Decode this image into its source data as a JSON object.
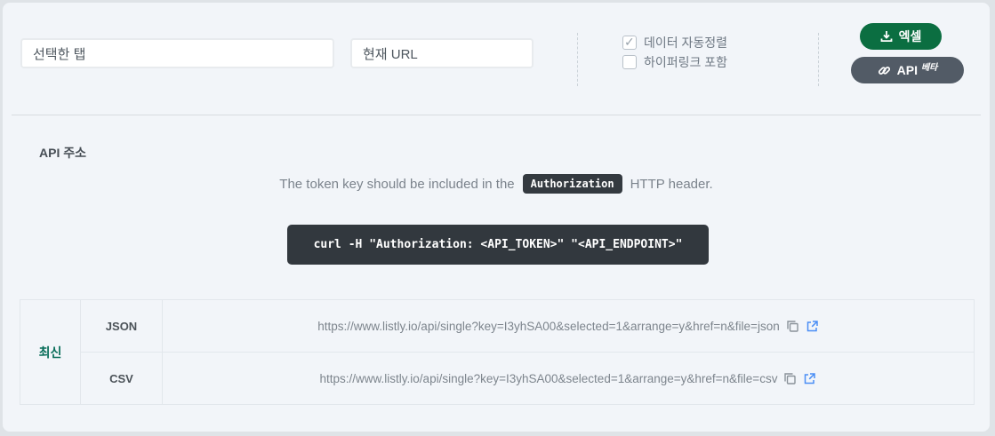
{
  "export_bar": {
    "selected_tab_input": {
      "value": "선택한 탭"
    },
    "current_url_input": {
      "value": "현재 URL"
    },
    "checkboxes": [
      {
        "label": "데이터 자동정렬",
        "checked": true
      },
      {
        "label": "하이퍼링크 포함",
        "checked": false
      }
    ],
    "excel_button": {
      "label": "엑셀",
      "icon": "download-icon",
      "color": "#0b6e41"
    },
    "api_button": {
      "label": "API",
      "badge": "베타",
      "icon": "link-icon",
      "color": "#525b66"
    }
  },
  "api_section": {
    "title": "API 주소",
    "token_note": {
      "prefix": "The token key should be included in the",
      "badge": "Authorization",
      "suffix": "HTTP header."
    },
    "curl_command": "curl -H \"Authorization: <API_TOKEN>\" \"<API_ENDPOINT>\"",
    "table": {
      "group_label": "최신",
      "rows": [
        {
          "format": "JSON",
          "url": "https://www.listly.io/api/single?key=I3yhSA00&selected=1&arrange=y&href=n&file=json"
        },
        {
          "format": "CSV",
          "url": "https://www.listly.io/api/single?key=I3yhSA00&selected=1&arrange=y&href=n&file=csv"
        }
      ],
      "row_icons": [
        "copy-icon",
        "external-link-icon"
      ]
    }
  },
  "colors": {
    "card_bg": "#f2f5f9",
    "page_bg": "#dfe3e7",
    "excel_green": "#0b6e41",
    "api_gray": "#525b66",
    "code_bg": "#32383e",
    "badge_bg": "#343a40",
    "latest_teal": "#086d59",
    "link_blue": "#4b8ef5",
    "copy_gray": "#8a9299"
  }
}
